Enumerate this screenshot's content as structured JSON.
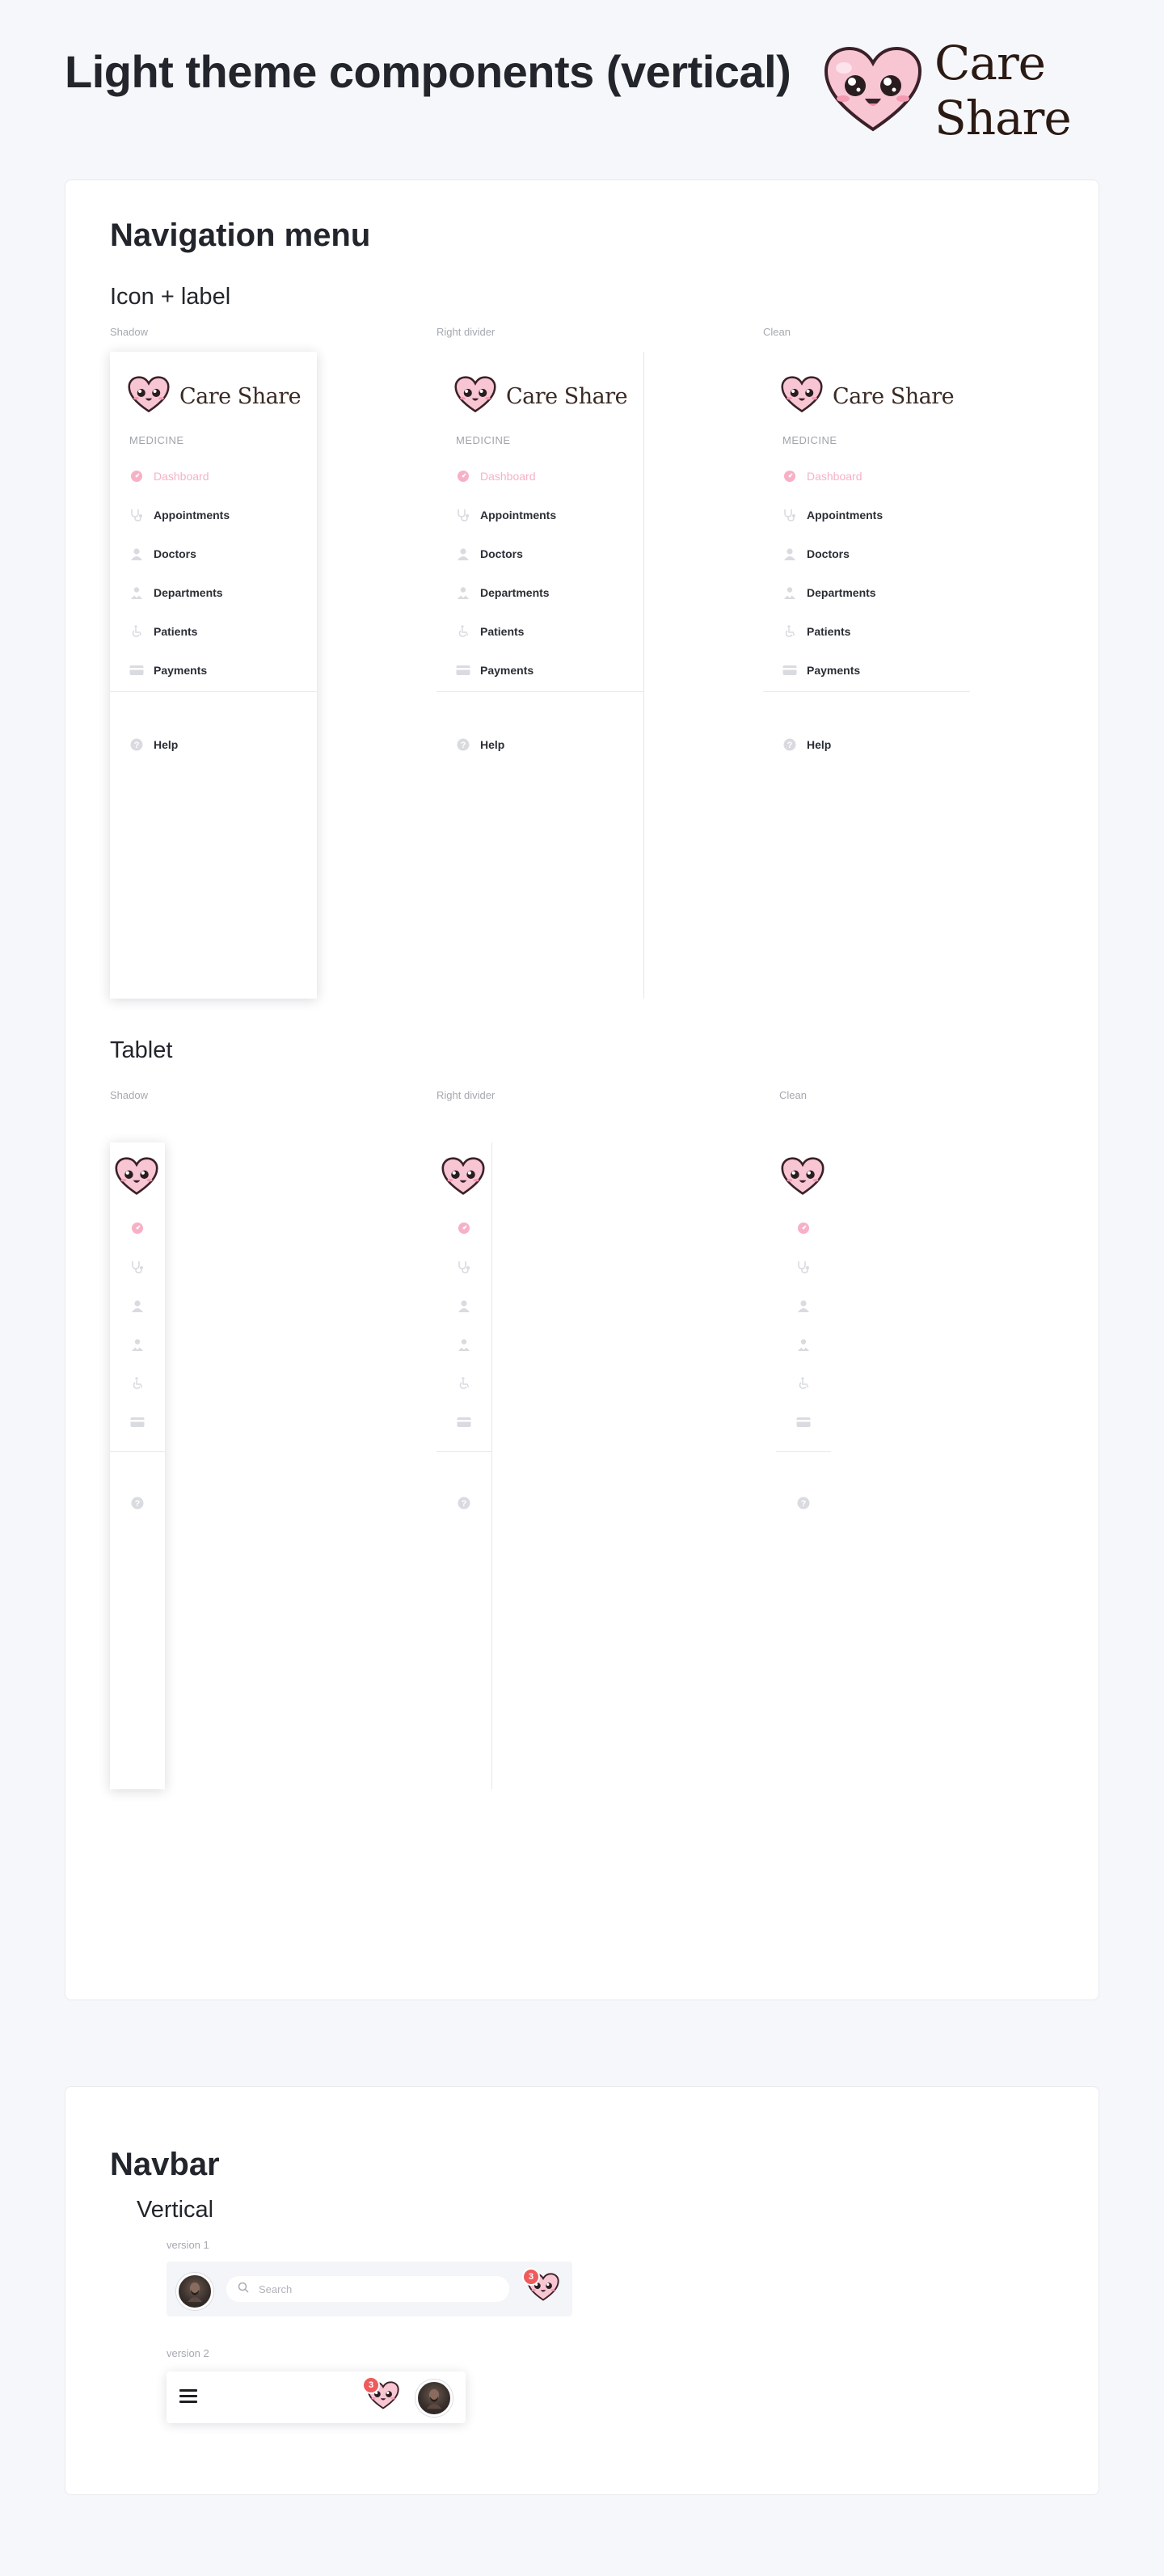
{
  "page": {
    "title": "Light theme components (vertical)",
    "brand": "Care Share"
  },
  "colors": {
    "accent_pink": "#f7b1c6",
    "heart_fill": "#f8c5d3",
    "badge_red": "#ef5b5b",
    "text_dark": "#22252b",
    "muted": "#a5a8b0"
  },
  "nav_menu": {
    "title": "Navigation menu",
    "icon_label": {
      "subtitle": "Icon + label",
      "variants": [
        "Shadow",
        "Right divider",
        "Clean"
      ],
      "section_label": "MEDICINE",
      "items": [
        {
          "label": "Dashboard",
          "icon": "dashboard-gauge-icon",
          "active": true
        },
        {
          "label": "Appointments",
          "icon": "stethoscope-icon",
          "active": false
        },
        {
          "label": "Doctors",
          "icon": "user-icon",
          "active": false
        },
        {
          "label": "Departments",
          "icon": "doctor-icon",
          "active": false
        },
        {
          "label": "Patients",
          "icon": "wheelchair-icon",
          "active": false
        },
        {
          "label": "Payments",
          "icon": "credit-card-icon",
          "active": false
        }
      ],
      "help_label": "Help"
    },
    "tablet": {
      "subtitle": "Tablet",
      "variants": [
        "Shadow",
        "Right divider",
        "Clean"
      ]
    }
  },
  "navbar": {
    "title": "Navbar",
    "subtitle": "Vertical",
    "v1": {
      "label": "version 1",
      "search_placeholder": "Search",
      "badge_count": "3"
    },
    "v2": {
      "label": "version 2",
      "badge_count": "3"
    }
  }
}
